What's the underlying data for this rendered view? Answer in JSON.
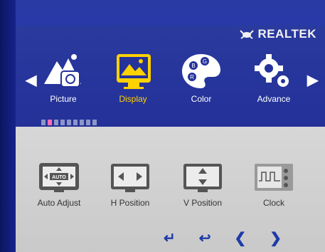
{
  "brand": {
    "name": "REALTEK"
  },
  "tabs": [
    {
      "label": "Picture",
      "icon": "picture-icon"
    },
    {
      "label": "Display",
      "icon": "display-icon",
      "active": true
    },
    {
      "label": "Color",
      "icon": "color-palette-icon"
    },
    {
      "label": "Advance",
      "icon": "gear-icon"
    }
  ],
  "page_indicator": {
    "total": 9,
    "current": 2
  },
  "items": [
    {
      "label": "Auto Adjust",
      "icon_text": "AUTO"
    },
    {
      "label": "H Position"
    },
    {
      "label": "V Position"
    },
    {
      "label": "Clock"
    }
  ],
  "colors": {
    "accent": "#ffd200",
    "panel_blue": "#24329a",
    "content_gray": "#d2d2d2"
  }
}
